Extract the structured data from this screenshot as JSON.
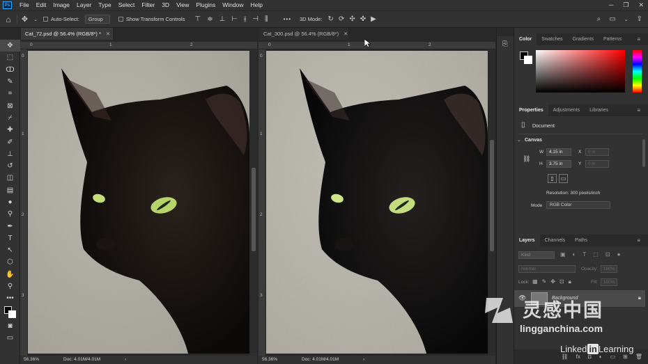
{
  "app": {
    "logo": "Ps"
  },
  "menu": [
    "File",
    "Edit",
    "Image",
    "Layer",
    "Type",
    "Select",
    "Filter",
    "3D",
    "View",
    "Plugins",
    "Window",
    "Help"
  ],
  "window_controls": [
    "─",
    "❐",
    "✕"
  ],
  "options_bar": {
    "auto_select_label": "Auto-Select:",
    "auto_select_value": "Group",
    "show_transform_label": "Show Transform Controls",
    "more": "•••",
    "mode_3d_label": "3D Mode:"
  },
  "documents": [
    {
      "tab": "Cat_72.psd @ 56.4% (RGB/8*) *",
      "zoom": "56.36%",
      "doc_info": "Doc: 4.01M/4.01M",
      "ruler_h": [
        "0",
        "1",
        "2"
      ],
      "ruler_v": [
        "0",
        "1",
        "2",
        "3"
      ],
      "status_chevron": "›"
    },
    {
      "tab": "Cat_300.psd @ 56.4% (RGB/8*)",
      "zoom": "56.36%",
      "doc_info": "Doc: 4.01M/4.01M",
      "ruler_h": [
        "0",
        "1",
        "2"
      ],
      "ruler_v": [
        "0",
        "1",
        "2",
        "3"
      ],
      "status_chevron": "›"
    }
  ],
  "color_panel": {
    "tabs": [
      "Color",
      "Swatches",
      "Gradients",
      "Patterns"
    ]
  },
  "properties_panel": {
    "tabs": [
      "Properties",
      "Adjustments",
      "Libraries"
    ],
    "document_label": "Document",
    "canvas_label": "Canvas",
    "w_label": "W",
    "w_value": "4.15 in",
    "x_label": "X",
    "x_value": "0 in",
    "h_label": "H",
    "h_value": "3.75 in",
    "y_label": "Y",
    "y_value": "0 in",
    "resolution": "Resolution: 300 pixels/inch",
    "mode_label": "Mode",
    "mode_value": "RGB Color"
  },
  "layers_panel": {
    "tabs": [
      "Layers",
      "Channels",
      "Paths"
    ],
    "search_placeholder": "Kind",
    "blend_mode": "Normal",
    "opacity_label": "Opacity:",
    "opacity_value": "100%",
    "lock_label": "Lock:",
    "fill_label": "Fill:",
    "fill_value": "100%",
    "layer_name": "Background"
  },
  "watermark": {
    "brand_cn": "灵感中国",
    "brand_url": "lingganchina.com",
    "linkedin_a": "Linked",
    "linkedin_b": "in",
    "linkedin_c": " Learning"
  },
  "colors": {
    "chrome": "#323232",
    "canvas_bg": "#282828",
    "accent": "#31a8ff"
  }
}
